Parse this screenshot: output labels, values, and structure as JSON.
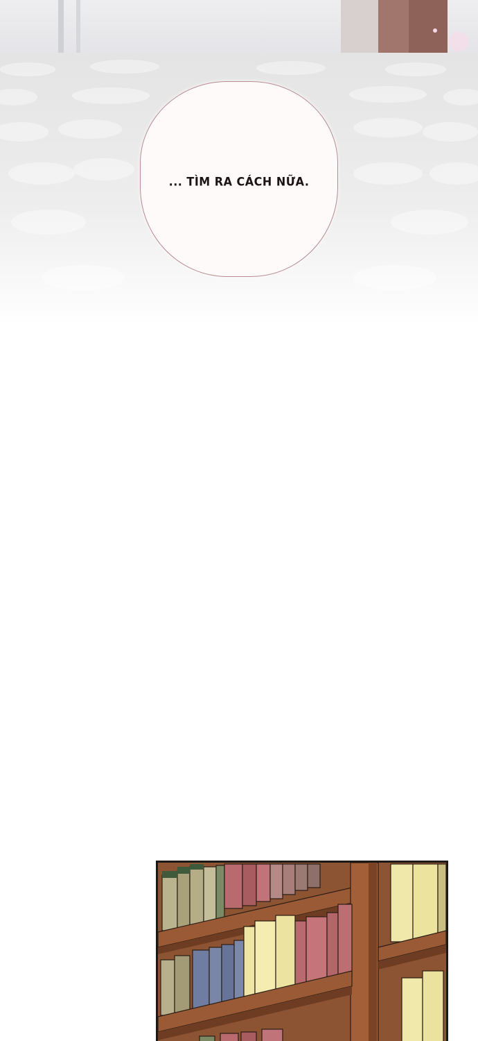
{
  "speech_bubble": {
    "text": "... TÌM RA CÁCH NỮA."
  },
  "colors": {
    "floor": "#e6e6e6",
    "bubble_fill": "#fefafa",
    "bubble_border": "#b98a90",
    "wood": "#9a5a36",
    "wood_dark": "#6e3c22"
  }
}
